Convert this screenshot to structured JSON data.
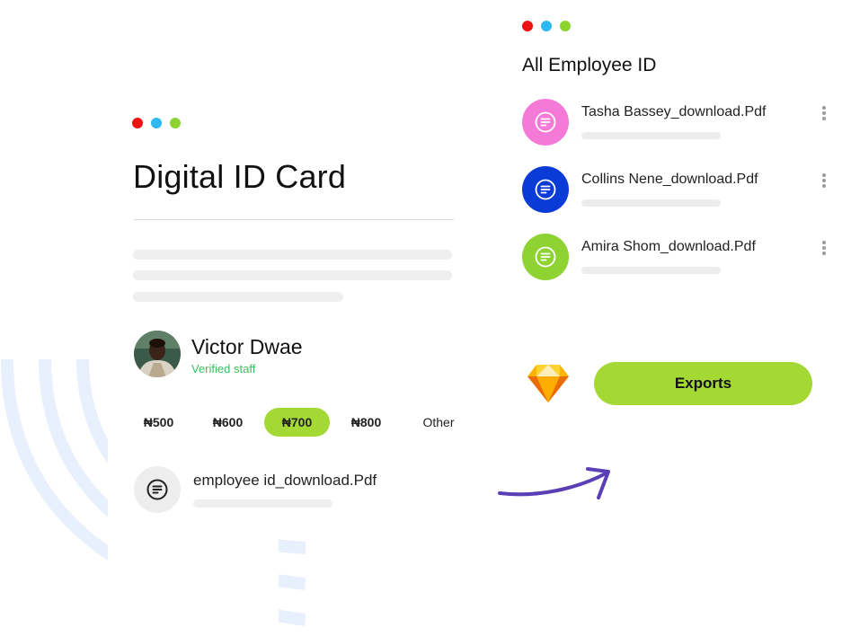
{
  "colors": {
    "dot_red": "#ee1111",
    "dot_blue": "#2fb9f2",
    "dot_green": "#8ed332",
    "accent": "#a4d935",
    "verified_green": "#3bbf5c",
    "arrow": "#5a3fb6"
  },
  "card": {
    "title": "Digital ID Card",
    "person": {
      "name": "Victor Dwae",
      "status": "Verified staff"
    },
    "amounts": [
      {
        "label": "₦500",
        "selected": false
      },
      {
        "label": "₦600",
        "selected": false
      },
      {
        "label": "₦700",
        "selected": true
      },
      {
        "label": "₦800",
        "selected": false
      },
      {
        "label": "Other",
        "selected": false
      }
    ],
    "file": {
      "name": "employee id_download.Pdf",
      "icon": "document-icon"
    }
  },
  "panel": {
    "title": "All Employee ID",
    "employees": [
      {
        "file": "Tasha Bassey_download.Pdf",
        "color": "#f57ad8",
        "icon": "document-icon"
      },
      {
        "file": "Collins Nene_download.Pdf",
        "color": "#0a3bd6",
        "icon": "document-icon"
      },
      {
        "file": "Amira Shom_download.Pdf",
        "color": "#8ed332",
        "icon": "document-icon"
      }
    ],
    "export_label": "Exports",
    "app_icon": "sketch-diamond-icon"
  }
}
